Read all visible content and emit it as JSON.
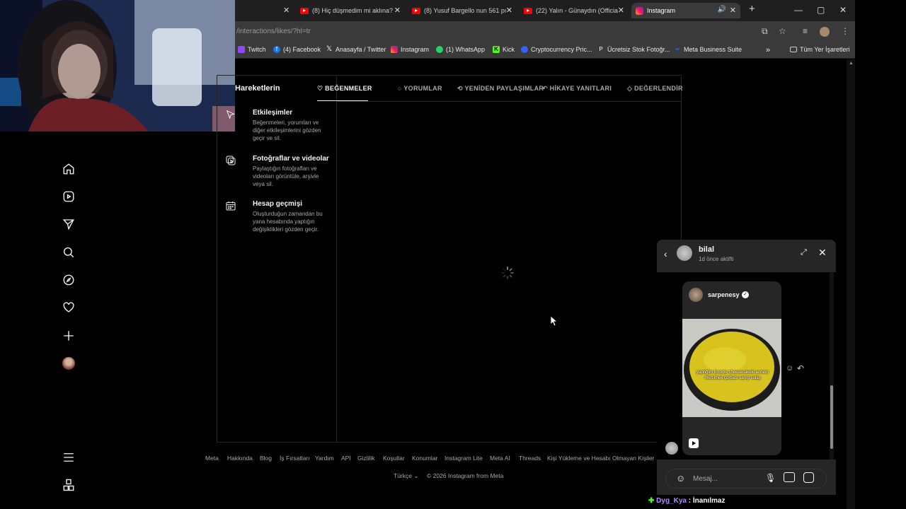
{
  "browser": {
    "tabs": [
      {
        "title": "(8) Hiç düşmedim mi aklına?",
        "favicon": "youtube-icon"
      },
      {
        "title": "(8) Yusuf Bargello nun 561 pı",
        "favicon": "youtube-icon"
      },
      {
        "title": "(22) Yalın - Günaydın (Officia",
        "favicon": "youtube-icon"
      },
      {
        "title": "Instagram",
        "favicon": "instagram-icon",
        "active": true
      }
    ],
    "address": "/interactions/likes/?hl=tr",
    "bookmarks": [
      {
        "label": "Twitch",
        "icon": "twitch-icon",
        "color": "#9146ff"
      },
      {
        "label": "(4) Facebook",
        "icon": "facebook-icon",
        "color": "#1877f2"
      },
      {
        "label": "Anasayfa / Twitter",
        "icon": "x-icon",
        "color": "#000000"
      },
      {
        "label": "Instagram",
        "icon": "instagram-icon",
        "color": "#e1306c"
      },
      {
        "label": "(1) WhatsApp",
        "icon": "whatsapp-icon",
        "color": "#25d366"
      },
      {
        "label": "Kick",
        "icon": "kick-icon",
        "color": "#53fc18"
      },
      {
        "label": "Cryptocurrency Pric...",
        "icon": "coinmarketcap-icon",
        "color": "#3861fb"
      },
      {
        "label": "Ücretsiz Stok Fotoğr...",
        "icon": "pexels-icon",
        "color": "#05a081"
      },
      {
        "label": "Meta Business Suite",
        "icon": "meta-icon",
        "color": "#0668e1"
      }
    ],
    "all_bookmarks": "Tüm Yer İşaretleri"
  },
  "panel": {
    "header": "Hareketlerin",
    "tabs": [
      "BEĞENMELER",
      "YORUMLAR",
      "YENİDEN PAYLAŞIMLAR",
      "HİKAYE YANITLARI",
      "DEĞERLENDİR"
    ],
    "active_tab": "BEĞENMELER",
    "menu": [
      {
        "title": "Etkileşimler",
        "desc": "Beğenmeleri, yorumları ve diğer etkileşimlerini gözden geçir ve sil.",
        "icon": "interactions-icon"
      },
      {
        "title": "Fotoğraflar ve videolar",
        "desc": "Paylaştığın fotoğrafları ve videoları görüntüle, arşivle veya sil.",
        "icon": "photos-videos-icon"
      },
      {
        "title": "Hesap geçmişi",
        "desc": "Oluşturduğun zamandan bu yana hesabında yaptığın değişiklikleri gözden geçir.",
        "icon": "calendar-icon"
      }
    ]
  },
  "footer": {
    "links": [
      "Meta",
      "Hakkında",
      "Blog",
      "İş Fırsatları",
      "Yardım",
      "API",
      "Gizlilik",
      "Koşullar",
      "Konumlar",
      "Instagram Lite",
      "Meta AI",
      "Threads",
      "Kişi Yükleme ve Hesabı Olmayan Kişiler"
    ],
    "language": "Türkçe",
    "copyright": "© 2026 Instagram from Meta"
  },
  "chat": {
    "name": "bilal",
    "status": "1d önce aktifti",
    "post_author": "sarpenesy",
    "post_caption": "yaptığım limonlu cheesecakeki annem mercimek çorbası sanıp sulaş",
    "input_placeholder": "Mesaj..."
  },
  "stream_chat": {
    "user": "Dyg_Kya",
    "message": ": İnanılmaz"
  }
}
